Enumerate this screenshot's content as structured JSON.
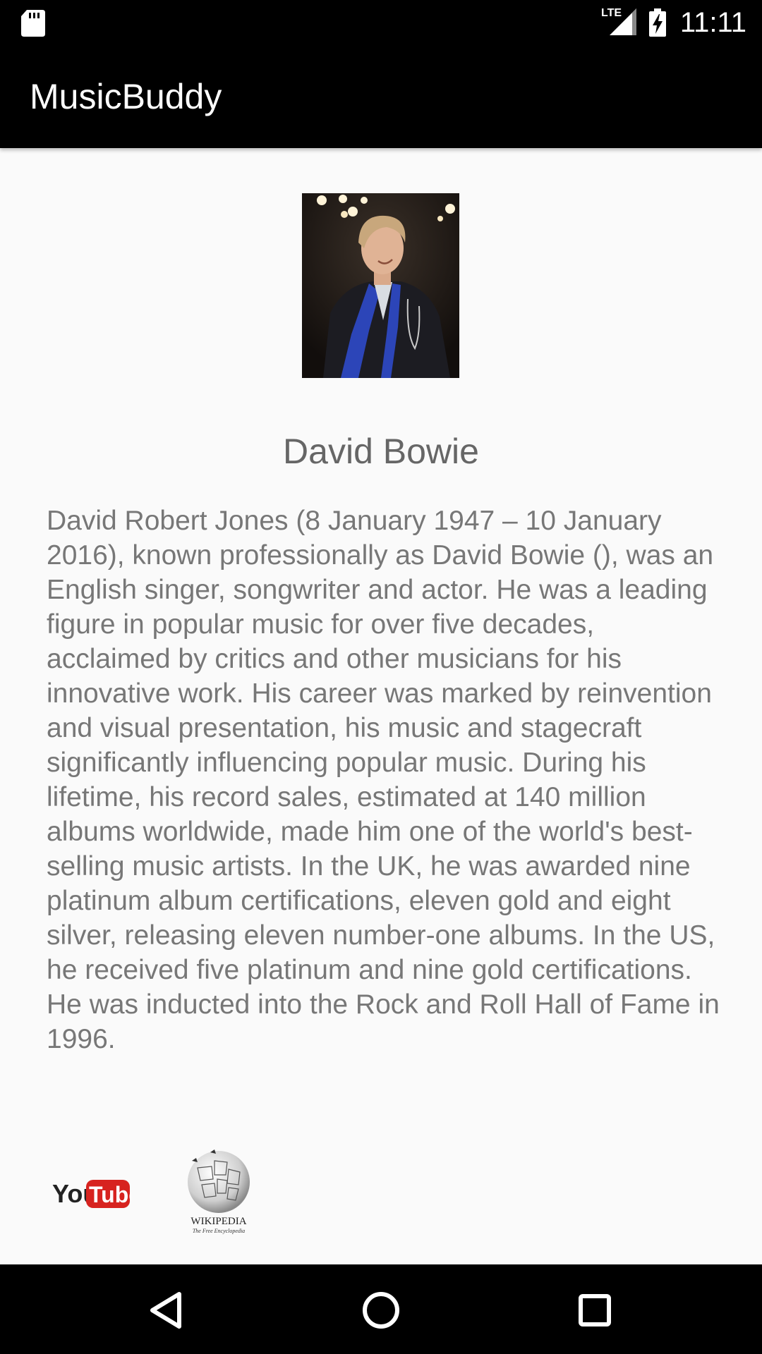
{
  "status_bar": {
    "time": "11:11",
    "network": "LTE",
    "icons": [
      "sd-card-icon",
      "lte-signal-icon",
      "battery-charging-icon"
    ]
  },
  "app_bar": {
    "title": "MusicBuddy"
  },
  "artist": {
    "name": "David Bowie",
    "photo_icon": "artist-photo",
    "bio": "David Robert Jones (8 January 1947 – 10 January 2016), known professionally as David Bowie (), was an English singer, songwriter and actor. He was a leading figure in popular music for over five decades, acclaimed by critics and other musicians for his innovative work. His career was marked by reinvention and visual presentation, his music and stagecraft significantly influencing popular music. During his lifetime, his record sales, estimated at 140 million albums worldwide, made him one of the world's best-selling music artists. In the UK, he was awarded nine platinum album certifications, eleven gold and eight silver, releasing eleven number-one albums. In the US, he received five platinum and nine gold certifications. He was inducted into the Rock and Roll Hall of Fame in 1996."
  },
  "links": {
    "youtube": {
      "you": "You",
      "tube": "Tube"
    },
    "wikipedia": {
      "name": "WIKIPEDIA",
      "tagline": "The Free Encyclopedia"
    }
  },
  "nav_bar": {
    "buttons": [
      "back-icon",
      "home-icon",
      "recents-icon"
    ]
  },
  "colors": {
    "bar_background": "#000000",
    "page_background": "#fafafa",
    "text": "#777777",
    "youtube_red": "#d7231f"
  }
}
